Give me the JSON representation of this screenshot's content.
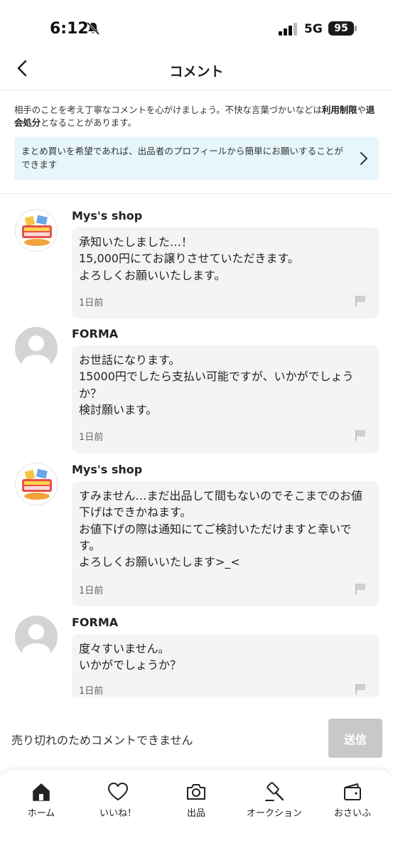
{
  "status_bar": {
    "time": "6:12",
    "network": "5G",
    "battery": "95"
  },
  "header": {
    "title": "コメント"
  },
  "notice": {
    "part1": "相手のことを考え丁寧なコメントを心がけましょう。不快な言葉づかいなどは",
    "bold1": "利用制限",
    "part2": "や",
    "bold2": "退会処分",
    "part3": "となることがあります。"
  },
  "info_banner": {
    "text": "まとめ買いを希望であれば、出品者のプロフィールから簡単にお願いすることができます"
  },
  "comments": [
    {
      "name": "Mys's shop",
      "text": "承知いたしました…！\n15,000円にてお譲りさせていただきます。\nよろしくお願いいたします。",
      "time": "1日前"
    },
    {
      "name": "FORMA",
      "text": "お世話になります。\n15000円でしたら支払い可能ですが、いかがでしょうか？\n検討願います。",
      "time": "1日前"
    },
    {
      "name": "Mys's shop",
      "text": "すみません…まだ出品して間もないのでそこまでのお値下げはできかねます。\nお値下げの際は通知にてご検討いただけますと幸いです。\nよろしくお願いいたします>_<",
      "time": "1日前"
    },
    {
      "name": "FORMA",
      "text": "度々すいません。\nいかがでしょうか？",
      "time": "1日前"
    }
  ],
  "footer": {
    "closed_message": "売り切れのためコメントできません",
    "send_label": "送信"
  },
  "bottom_nav": [
    {
      "label": "ホーム",
      "icon": "home-icon"
    },
    {
      "label": "いいね！",
      "icon": "heart-icon"
    },
    {
      "label": "出品",
      "icon": "camera-icon"
    },
    {
      "label": "オークション",
      "icon": "gavel-icon"
    },
    {
      "label": "おさいふ",
      "icon": "wallet-icon"
    }
  ],
  "colors": {
    "banner_bg": "#e7f6fb",
    "bubble_bg": "#f4f4f4",
    "send_disabled": "#c8c8c8"
  }
}
